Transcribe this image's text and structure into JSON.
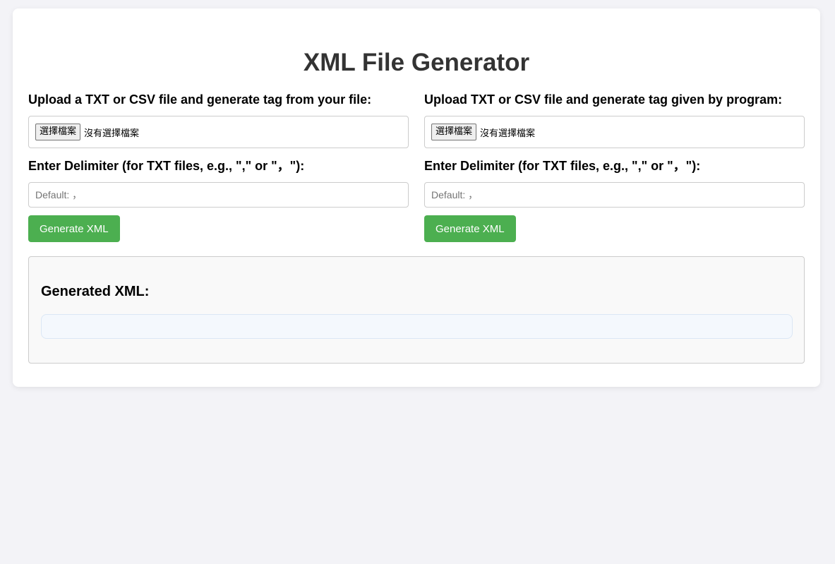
{
  "page": {
    "title": "XML File Generator"
  },
  "colors": {
    "background": "#f3f3f7",
    "card": "#ffffff",
    "accent": "#4caf50",
    "output_bg": "#f9f9f9",
    "pre_bg": "#f4f8fd"
  },
  "sections": [
    {
      "upload_label": "Upload a TXT or CSV file and generate tag from your file:",
      "file_button": "選擇檔案",
      "file_status": "沒有選擇檔案",
      "delimiter_label": "Enter Delimiter (for TXT files, e.g., \",\" or \"，\"):",
      "delimiter_placeholder": "Default: ，",
      "delimiter_value": "",
      "generate_label": "Generate XML"
    },
    {
      "upload_label": "Upload TXT or CSV file and generate tag given by program:",
      "file_button": "選擇檔案",
      "file_status": "沒有選擇檔案",
      "delimiter_label": "Enter Delimiter (for TXT files, e.g., \",\" or \"，\"):",
      "delimiter_placeholder": "Default: ，",
      "delimiter_value": "",
      "generate_label": "Generate XML"
    }
  ],
  "output": {
    "heading": "Generated XML:",
    "content": ""
  }
}
